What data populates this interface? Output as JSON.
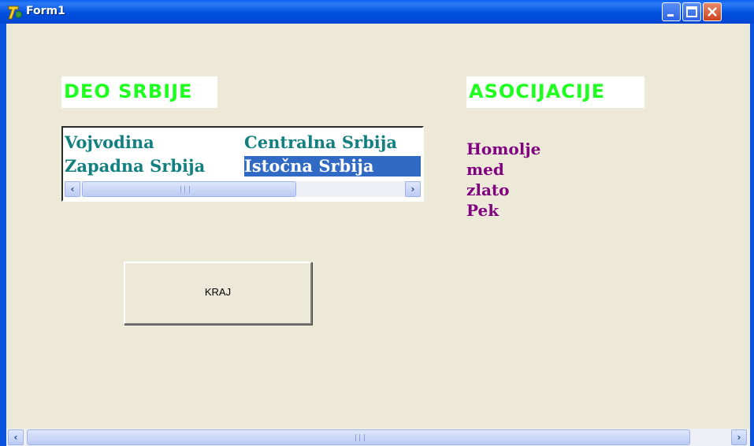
{
  "window": {
    "title": "Form1"
  },
  "headings": {
    "deo": "DEO SRBIJE",
    "asocijacije": "ASOCIJACIJE"
  },
  "listbox": {
    "items": [
      "Vojvodina",
      "Zapadna Srbija",
      "Centralna Srbija",
      "Istočna Srbija"
    ],
    "selected_index": 3
  },
  "associations": [
    "Homolje",
    "med",
    "zlato",
    "Pek"
  ],
  "buttons": {
    "kraj": "KRAJ"
  },
  "colors": {
    "heading_text": "#1fff1f",
    "list_text": "#128080",
    "selection": "#316ac5",
    "association_text": "#800080",
    "client_bg": "#ece9d8"
  },
  "icons": {
    "app": "delphi-app-icon",
    "minimize": "minimize-icon",
    "maximize": "maximize-icon",
    "close": "close-icon",
    "scroll_left": "arrow-left-icon",
    "scroll_right": "arrow-right-icon"
  }
}
